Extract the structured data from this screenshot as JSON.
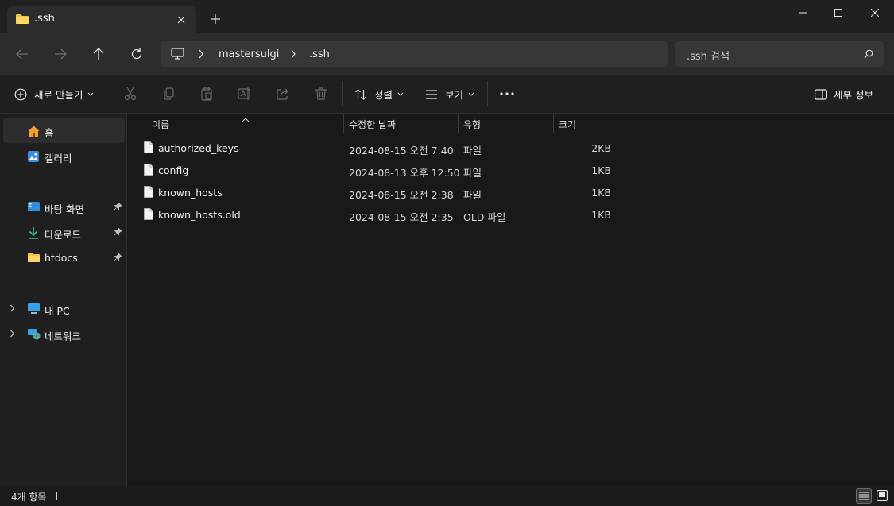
{
  "window": {
    "tab_title": ".ssh",
    "new_tab_symbol": "+"
  },
  "nav": {
    "breadcrumbs": [
      "mastersulgi",
      ".ssh"
    ],
    "search_placeholder": ".ssh 검색"
  },
  "toolbar": {
    "new_label": "새로 만들기",
    "sort_label": "정렬",
    "view_label": "보기",
    "details_label": "세부 정보"
  },
  "sidebar": {
    "items": [
      {
        "label": "홈",
        "icon": "home-icon"
      },
      {
        "label": "갤러리",
        "icon": "gallery-icon"
      },
      {
        "label": "바탕 화면",
        "icon": "desktop-icon",
        "pinned": true
      },
      {
        "label": "다운로드",
        "icon": "download-icon",
        "pinned": true
      },
      {
        "label": "htdocs",
        "icon": "folder-icon",
        "pinned": true
      },
      {
        "label": "내 PC",
        "icon": "pc-icon"
      },
      {
        "label": "네트워크",
        "icon": "network-icon"
      }
    ]
  },
  "columns": {
    "name": "이름",
    "modified": "수정한 날짜",
    "type": "유형",
    "size": "크기"
  },
  "files": [
    {
      "name": "authorized_keys",
      "modified": "2024-08-15 오전 7:40",
      "type": "파일",
      "size": "2KB"
    },
    {
      "name": "config",
      "modified": "2024-08-13 오후 12:50",
      "type": "파일",
      "size": "1KB"
    },
    {
      "name": "known_hosts",
      "modified": "2024-08-15 오전 2:38",
      "type": "파일",
      "size": "1KB"
    },
    {
      "name": "known_hosts.old",
      "modified": "2024-08-15 오전 2:35",
      "type": "OLD 파일",
      "size": "1KB"
    }
  ],
  "status": {
    "item_count": "4개 항목"
  },
  "colors": {
    "folder": "#f4c04e",
    "accent": "#4cc2ff",
    "background": "#191919"
  }
}
